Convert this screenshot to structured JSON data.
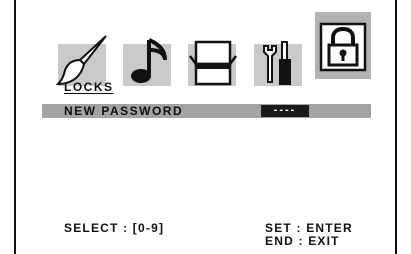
{
  "menu": {
    "tabs": [
      {
        "name": "picture",
        "icon": "paintbrush-icon"
      },
      {
        "name": "sound",
        "icon": "music-note-icon"
      },
      {
        "name": "channel",
        "icon": "tv-box-icon"
      },
      {
        "name": "setup",
        "icon": "tools-icon"
      },
      {
        "name": "locks",
        "icon": "padlock-icon",
        "active": true
      }
    ],
    "section_title": "LOCKS"
  },
  "row": {
    "label": "NEW PASSWORD",
    "value": "----"
  },
  "footer": {
    "select_hint": "SELECT : [0-9]",
    "set_hint": "SET : ENTER",
    "end_hint": "END : EXIT"
  },
  "colors": {
    "tab_bg": "#c9c9c9",
    "active_tab_bg": "#b3b3b3",
    "row_bg": "#a3a3a3",
    "value_bg": "#1a1a1a"
  }
}
